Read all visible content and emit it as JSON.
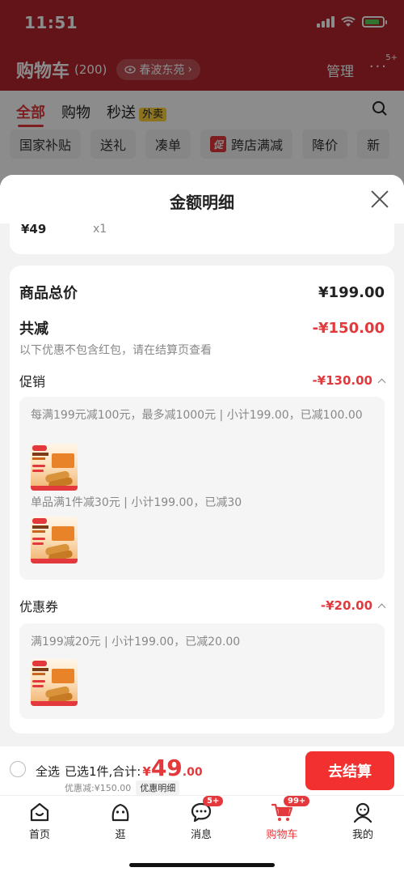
{
  "status_bar": {
    "time": "11:51"
  },
  "background": {
    "cart_title": "购物车",
    "cart_count": "(200)",
    "location": "春波东苑",
    "manage": "管理",
    "more_badge": "5+",
    "tabs": [
      "全部",
      "购物",
      "秒送"
    ],
    "waimai_badge": "外卖",
    "chips": [
      "国家补贴",
      "送礼",
      "凑单",
      "跨店满减",
      "降价",
      "新"
    ],
    "chip_badge": "促"
  },
  "sheet": {
    "title": "金额明细",
    "item": {
      "price": "¥49",
      "qty": "x1"
    },
    "total_label": "商品总价",
    "total_value": "¥199.00",
    "reduce_label": "共减",
    "reduce_value": "-¥150.00",
    "reduce_note": "以下优惠不包含红包，请在结算页查看",
    "promo": {
      "label": "促销",
      "value": "-¥130.00",
      "rule1": "每满199元减100元，最多减1000元 | 小计199.00，已减100.00",
      "rule2": "单品满1件减30元 | 小计199.00，已减30"
    },
    "coupon": {
      "label": "优惠券",
      "value": "-¥20.00",
      "rule1": "满199减20元 | 小计199.00，已减20.00"
    }
  },
  "checkout": {
    "select_all": "全选",
    "summary_text": "已选1件,合计:",
    "currency": "¥",
    "amount_int": "49",
    "amount_dec": ".00",
    "discount_text": "优惠减:¥150.00",
    "detail_link": "优惠明细",
    "checkout_button": "去结算"
  },
  "nav": {
    "items": [
      {
        "label": "首页",
        "icon": "home-icon"
      },
      {
        "label": "逛",
        "icon": "browse-icon"
      },
      {
        "label": "消息",
        "icon": "message-icon",
        "badge": "5+"
      },
      {
        "label": "购物车",
        "icon": "cart-icon",
        "badge": "99+"
      },
      {
        "label": "我的",
        "icon": "profile-icon"
      }
    ]
  },
  "colors": {
    "accent": "#e4393c",
    "header_red": "#b3262d",
    "checkout_button": "#f23030"
  }
}
